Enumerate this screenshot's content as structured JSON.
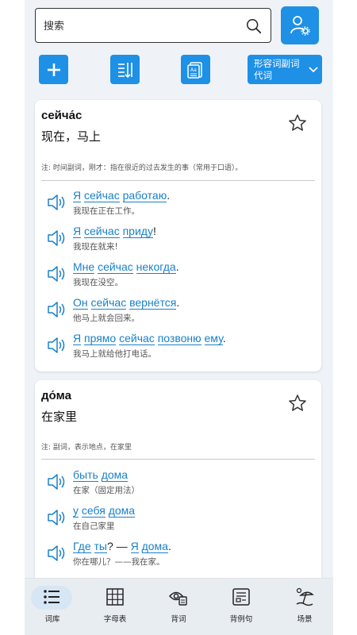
{
  "search": {
    "placeholder": "搜索"
  },
  "toolbar": {
    "filter_label": "形容词副词代词"
  },
  "cards": [
    {
      "word": "сейча́с",
      "meaning": "现在，马上",
      "note": "注: 时间副词，刚才：指在很近的过去发生的事（常用于口语）。",
      "examples": [
        {
          "ru": [
            "Я",
            " ",
            "сейчас",
            " ",
            "работаю",
            "."
          ],
          "zh": "我现在正在工作。"
        },
        {
          "ru": [
            "Я",
            " ",
            "сейчас",
            " ",
            "приду",
            "!"
          ],
          "zh": "我现在就来!"
        },
        {
          "ru": [
            "Мне",
            " ",
            "сейчас",
            " ",
            "некогда",
            "."
          ],
          "zh": "我现在没空。"
        },
        {
          "ru": [
            "Он",
            " ",
            "сейчас",
            " ",
            "вернётся",
            "."
          ],
          "zh": "他马上就会回来。"
        },
        {
          "ru": [
            "Я",
            " ",
            "прямо",
            " ",
            "сейчас",
            " ",
            "позвоню",
            " ",
            "ему",
            "."
          ],
          "zh": "我马上就给他打电话。"
        }
      ]
    },
    {
      "word": "до́ма",
      "meaning": "在家里",
      "note": "注: 副词，表示地点，在家里",
      "examples": [
        {
          "ru": [
            "быть",
            " ",
            "дома"
          ],
          "zh": "在家（固定用法）"
        },
        {
          "ru": [
            "у",
            " ",
            "себя",
            " ",
            "дома"
          ],
          "zh": "在自己家里"
        },
        {
          "ru": [
            "Где",
            " ",
            "ты",
            "? — ",
            "Я",
            " ",
            "дома",
            "."
          ],
          "zh": "你在哪儿？——我在家。"
        }
      ]
    }
  ],
  "nav": [
    {
      "label": "词库",
      "icon": "list-icon",
      "active": true
    },
    {
      "label": "字母表",
      "icon": "grid-icon",
      "active": false
    },
    {
      "label": "背词",
      "icon": "eye-card-icon",
      "active": false
    },
    {
      "label": "背例句",
      "icon": "sentence-card-icon",
      "active": false
    },
    {
      "label": "场景",
      "icon": "beach-icon",
      "active": false
    }
  ],
  "colors": {
    "accent": "#1e90e6",
    "link": "#1a80c8",
    "panel": "#eff3f7"
  }
}
